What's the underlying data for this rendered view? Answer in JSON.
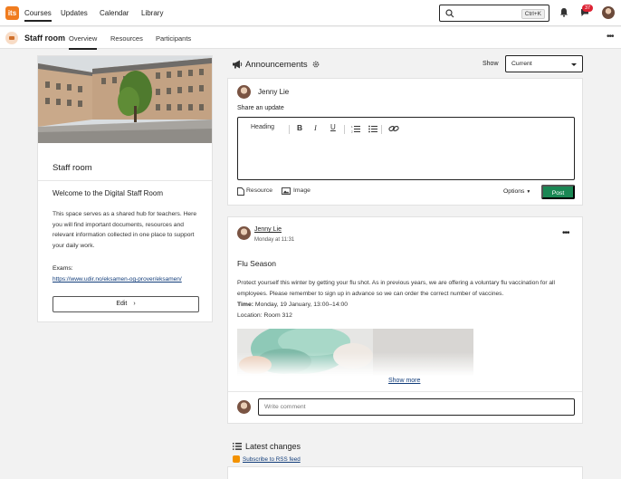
{
  "topnav": {
    "logo_text": "its",
    "links": [
      "Courses",
      "Updates",
      "Calendar",
      "Library"
    ],
    "search_shortcut": "Ctrl+K",
    "notification_count": "37"
  },
  "subnav": {
    "title": "Staff room",
    "tabs": [
      "Overview",
      "Resources",
      "Participants"
    ]
  },
  "left_card": {
    "title": "Staff room",
    "welcome": "Welcome to the Digital Staff Room",
    "description": "This space serves as a shared hub for teachers. Here you will find important documents, resources and relevant information collected in one place to support your daily work.",
    "exams_label": "Exams",
    "exams_link": "https://www.udir.no/eksamen-og-prover/eksamen/",
    "edit_label": "Edit"
  },
  "announcements": {
    "title": "Announcements",
    "show_label": "Show",
    "show_value": "Current"
  },
  "composer": {
    "user_name": "Jenny Lie",
    "share_label": "Share an update",
    "heading_label": "Heading",
    "resource_label": "Resource",
    "image_label": "Image",
    "options_label": "Options",
    "post_label": "Post"
  },
  "post": {
    "author": "Jenny Lie",
    "time": "Monday at 11:31",
    "title": "Flu Season",
    "body": "Protect yourself this winter by getting your flu shot. As in previous years, we are offering a voluntary flu vaccination for all employees. Please remember to sign up in advance so we can order the correct number of vaccines.",
    "time_label": "Time:",
    "time_value": "Monday, 19 January, 13:00–14:00",
    "location_label": "Location:",
    "location_value": "Room 312",
    "show_more": "Show more",
    "comment_placeholder": "Write comment"
  },
  "latest_changes": {
    "title": "Latest changes",
    "rss_label": "Subscribe to RSS feed"
  },
  "colors": {
    "brand_orange": "#f07c1f",
    "post_green": "#1a8754",
    "link_blue": "#123d7a",
    "badge_red": "#dd2233"
  }
}
